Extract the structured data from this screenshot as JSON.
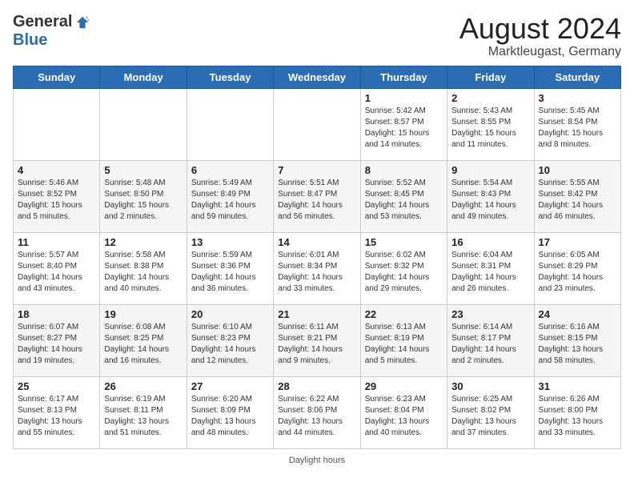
{
  "logo": {
    "general": "General",
    "blue": "Blue"
  },
  "title": {
    "month_year": "August 2024",
    "location": "Marktleugast, Germany"
  },
  "days_of_week": [
    "Sunday",
    "Monday",
    "Tuesday",
    "Wednesday",
    "Thursday",
    "Friday",
    "Saturday"
  ],
  "weeks": [
    [
      {
        "num": "",
        "sunrise": "",
        "sunset": "",
        "daylight": ""
      },
      {
        "num": "",
        "sunrise": "",
        "sunset": "",
        "daylight": ""
      },
      {
        "num": "",
        "sunrise": "",
        "sunset": "",
        "daylight": ""
      },
      {
        "num": "",
        "sunrise": "",
        "sunset": "",
        "daylight": ""
      },
      {
        "num": "1",
        "sunrise": "Sunrise: 5:42 AM",
        "sunset": "Sunset: 8:57 PM",
        "daylight": "Daylight: 15 hours and 14 minutes."
      },
      {
        "num": "2",
        "sunrise": "Sunrise: 5:43 AM",
        "sunset": "Sunset: 8:55 PM",
        "daylight": "Daylight: 15 hours and 11 minutes."
      },
      {
        "num": "3",
        "sunrise": "Sunrise: 5:45 AM",
        "sunset": "Sunset: 8:54 PM",
        "daylight": "Daylight: 15 hours and 8 minutes."
      }
    ],
    [
      {
        "num": "4",
        "sunrise": "Sunrise: 5:46 AM",
        "sunset": "Sunset: 8:52 PM",
        "daylight": "Daylight: 15 hours and 5 minutes."
      },
      {
        "num": "5",
        "sunrise": "Sunrise: 5:48 AM",
        "sunset": "Sunset: 8:50 PM",
        "daylight": "Daylight: 15 hours and 2 minutes."
      },
      {
        "num": "6",
        "sunrise": "Sunrise: 5:49 AM",
        "sunset": "Sunset: 8:49 PM",
        "daylight": "Daylight: 14 hours and 59 minutes."
      },
      {
        "num": "7",
        "sunrise": "Sunrise: 5:51 AM",
        "sunset": "Sunset: 8:47 PM",
        "daylight": "Daylight: 14 hours and 56 minutes."
      },
      {
        "num": "8",
        "sunrise": "Sunrise: 5:52 AM",
        "sunset": "Sunset: 8:45 PM",
        "daylight": "Daylight: 14 hours and 53 minutes."
      },
      {
        "num": "9",
        "sunrise": "Sunrise: 5:54 AM",
        "sunset": "Sunset: 8:43 PM",
        "daylight": "Daylight: 14 hours and 49 minutes."
      },
      {
        "num": "10",
        "sunrise": "Sunrise: 5:55 AM",
        "sunset": "Sunset: 8:42 PM",
        "daylight": "Daylight: 14 hours and 46 minutes."
      }
    ],
    [
      {
        "num": "11",
        "sunrise": "Sunrise: 5:57 AM",
        "sunset": "Sunset: 8:40 PM",
        "daylight": "Daylight: 14 hours and 43 minutes."
      },
      {
        "num": "12",
        "sunrise": "Sunrise: 5:58 AM",
        "sunset": "Sunset: 8:38 PM",
        "daylight": "Daylight: 14 hours and 40 minutes."
      },
      {
        "num": "13",
        "sunrise": "Sunrise: 5:59 AM",
        "sunset": "Sunset: 8:36 PM",
        "daylight": "Daylight: 14 hours and 36 minutes."
      },
      {
        "num": "14",
        "sunrise": "Sunrise: 6:01 AM",
        "sunset": "Sunset: 8:34 PM",
        "daylight": "Daylight: 14 hours and 33 minutes."
      },
      {
        "num": "15",
        "sunrise": "Sunrise: 6:02 AM",
        "sunset": "Sunset: 8:32 PM",
        "daylight": "Daylight: 14 hours and 29 minutes."
      },
      {
        "num": "16",
        "sunrise": "Sunrise: 6:04 AM",
        "sunset": "Sunset: 8:31 PM",
        "daylight": "Daylight: 14 hours and 26 minutes."
      },
      {
        "num": "17",
        "sunrise": "Sunrise: 6:05 AM",
        "sunset": "Sunset: 8:29 PM",
        "daylight": "Daylight: 14 hours and 23 minutes."
      }
    ],
    [
      {
        "num": "18",
        "sunrise": "Sunrise: 6:07 AM",
        "sunset": "Sunset: 8:27 PM",
        "daylight": "Daylight: 14 hours and 19 minutes."
      },
      {
        "num": "19",
        "sunrise": "Sunrise: 6:08 AM",
        "sunset": "Sunset: 8:25 PM",
        "daylight": "Daylight: 14 hours and 16 minutes."
      },
      {
        "num": "20",
        "sunrise": "Sunrise: 6:10 AM",
        "sunset": "Sunset: 8:23 PM",
        "daylight": "Daylight: 14 hours and 12 minutes."
      },
      {
        "num": "21",
        "sunrise": "Sunrise: 6:11 AM",
        "sunset": "Sunset: 8:21 PM",
        "daylight": "Daylight: 14 hours and 9 minutes."
      },
      {
        "num": "22",
        "sunrise": "Sunrise: 6:13 AM",
        "sunset": "Sunset: 8:19 PM",
        "daylight": "Daylight: 14 hours and 5 minutes."
      },
      {
        "num": "23",
        "sunrise": "Sunrise: 6:14 AM",
        "sunset": "Sunset: 8:17 PM",
        "daylight": "Daylight: 14 hours and 2 minutes."
      },
      {
        "num": "24",
        "sunrise": "Sunrise: 6:16 AM",
        "sunset": "Sunset: 8:15 PM",
        "daylight": "Daylight: 13 hours and 58 minutes."
      }
    ],
    [
      {
        "num": "25",
        "sunrise": "Sunrise: 6:17 AM",
        "sunset": "Sunset: 8:13 PM",
        "daylight": "Daylight: 13 hours and 55 minutes."
      },
      {
        "num": "26",
        "sunrise": "Sunrise: 6:19 AM",
        "sunset": "Sunset: 8:11 PM",
        "daylight": "Daylight: 13 hours and 51 minutes."
      },
      {
        "num": "27",
        "sunrise": "Sunrise: 6:20 AM",
        "sunset": "Sunset: 8:09 PM",
        "daylight": "Daylight: 13 hours and 48 minutes."
      },
      {
        "num": "28",
        "sunrise": "Sunrise: 6:22 AM",
        "sunset": "Sunset: 8:06 PM",
        "daylight": "Daylight: 13 hours and 44 minutes."
      },
      {
        "num": "29",
        "sunrise": "Sunrise: 6:23 AM",
        "sunset": "Sunset: 8:04 PM",
        "daylight": "Daylight: 13 hours and 40 minutes."
      },
      {
        "num": "30",
        "sunrise": "Sunrise: 6:25 AM",
        "sunset": "Sunset: 8:02 PM",
        "daylight": "Daylight: 13 hours and 37 minutes."
      },
      {
        "num": "31",
        "sunrise": "Sunrise: 6:26 AM",
        "sunset": "Sunset: 8:00 PM",
        "daylight": "Daylight: 13 hours and 33 minutes."
      }
    ]
  ],
  "footer": {
    "text": "Daylight hours",
    "url": "https://www.generalblue.com"
  }
}
